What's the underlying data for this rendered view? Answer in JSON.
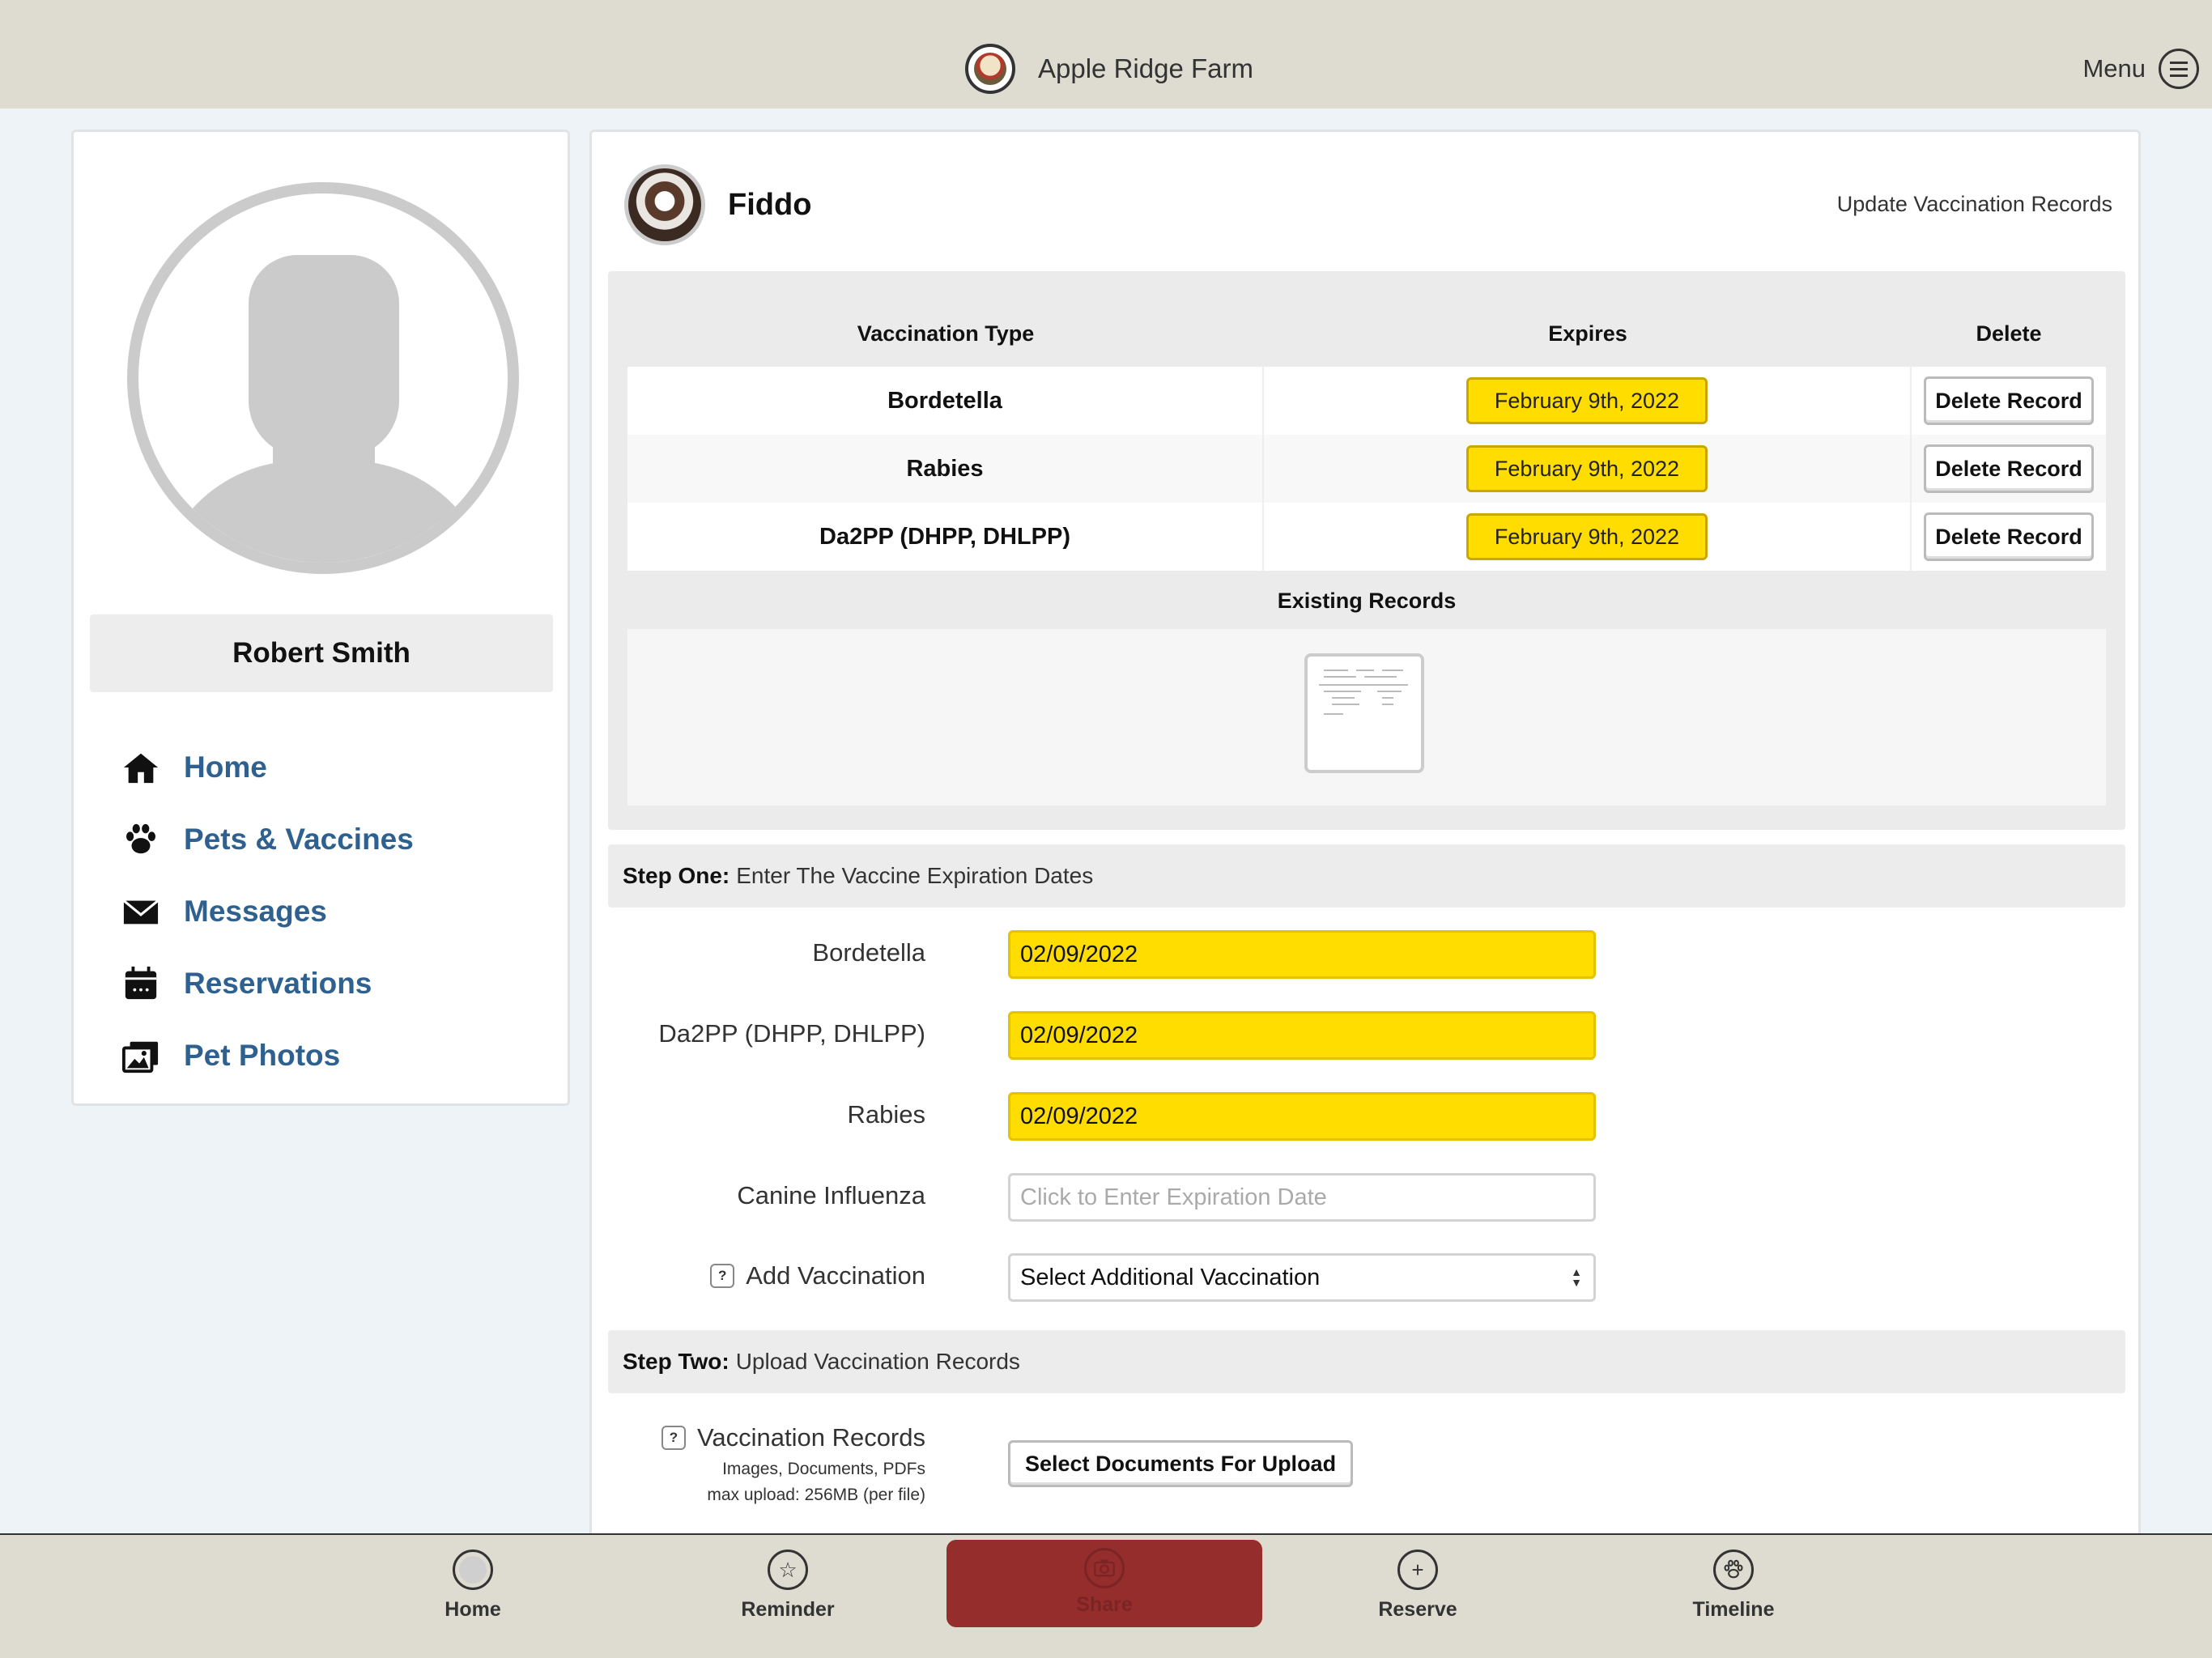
{
  "header": {
    "brand_name": "Apple Ridge Farm",
    "menu_label": "Menu"
  },
  "profile": {
    "name": "Robert Smith"
  },
  "sidebar": {
    "items": [
      {
        "label": "Home",
        "icon": "home-icon"
      },
      {
        "label": "Pets & Vaccines",
        "icon": "paw-icon"
      },
      {
        "label": "Messages",
        "icon": "envelope-icon"
      },
      {
        "label": "Reservations",
        "icon": "calendar-icon"
      },
      {
        "label": "Pet Photos",
        "icon": "photos-icon"
      }
    ]
  },
  "pet": {
    "name": "Fiddo",
    "update_link": "Update Vaccination Records"
  },
  "records": {
    "headers": {
      "type": "Vaccination Type",
      "expires": "Expires",
      "delete": "Delete"
    },
    "rows": [
      {
        "type": "Bordetella",
        "expires": "February 9th, 2022",
        "delete_label": "Delete Record"
      },
      {
        "type": "Rabies",
        "expires": "February 9th, 2022",
        "delete_label": "Delete Record"
      },
      {
        "type": "Da2PP (DHPP, DHLPP)",
        "expires": "February 9th, 2022",
        "delete_label": "Delete Record"
      }
    ],
    "existing_title": "Existing Records"
  },
  "step_one": {
    "bold": "Step One:",
    "text": "Enter The Vaccine Expiration Dates",
    "fields": [
      {
        "label": "Bordetella",
        "value": "02/09/2022"
      },
      {
        "label": "Da2PP (DHPP, DHLPP)",
        "value": "02/09/2022"
      },
      {
        "label": "Rabies",
        "value": "02/09/2022"
      },
      {
        "label": "Canine Influenza",
        "value": "",
        "placeholder": "Click to Enter Expiration Date"
      }
    ],
    "add_label": "Add Vaccination",
    "add_select": "Select Additional Vaccination"
  },
  "step_two": {
    "bold": "Step Two:",
    "text": "Upload Vaccination Records",
    "label": "Vaccination Records",
    "hint1": "Images, Documents, PDFs",
    "hint2": "max upload: 256MB (per file)",
    "button": "Select Documents For Upload"
  },
  "tabbar": {
    "home": "Home",
    "reminder": "Reminder",
    "share": "Share",
    "reserve": "Reserve",
    "timeline": "Timeline"
  },
  "colors": {
    "highlight": "#ffdd00",
    "link": "#2f6190",
    "share": "#962d2d",
    "bars": "#dedcd1"
  }
}
